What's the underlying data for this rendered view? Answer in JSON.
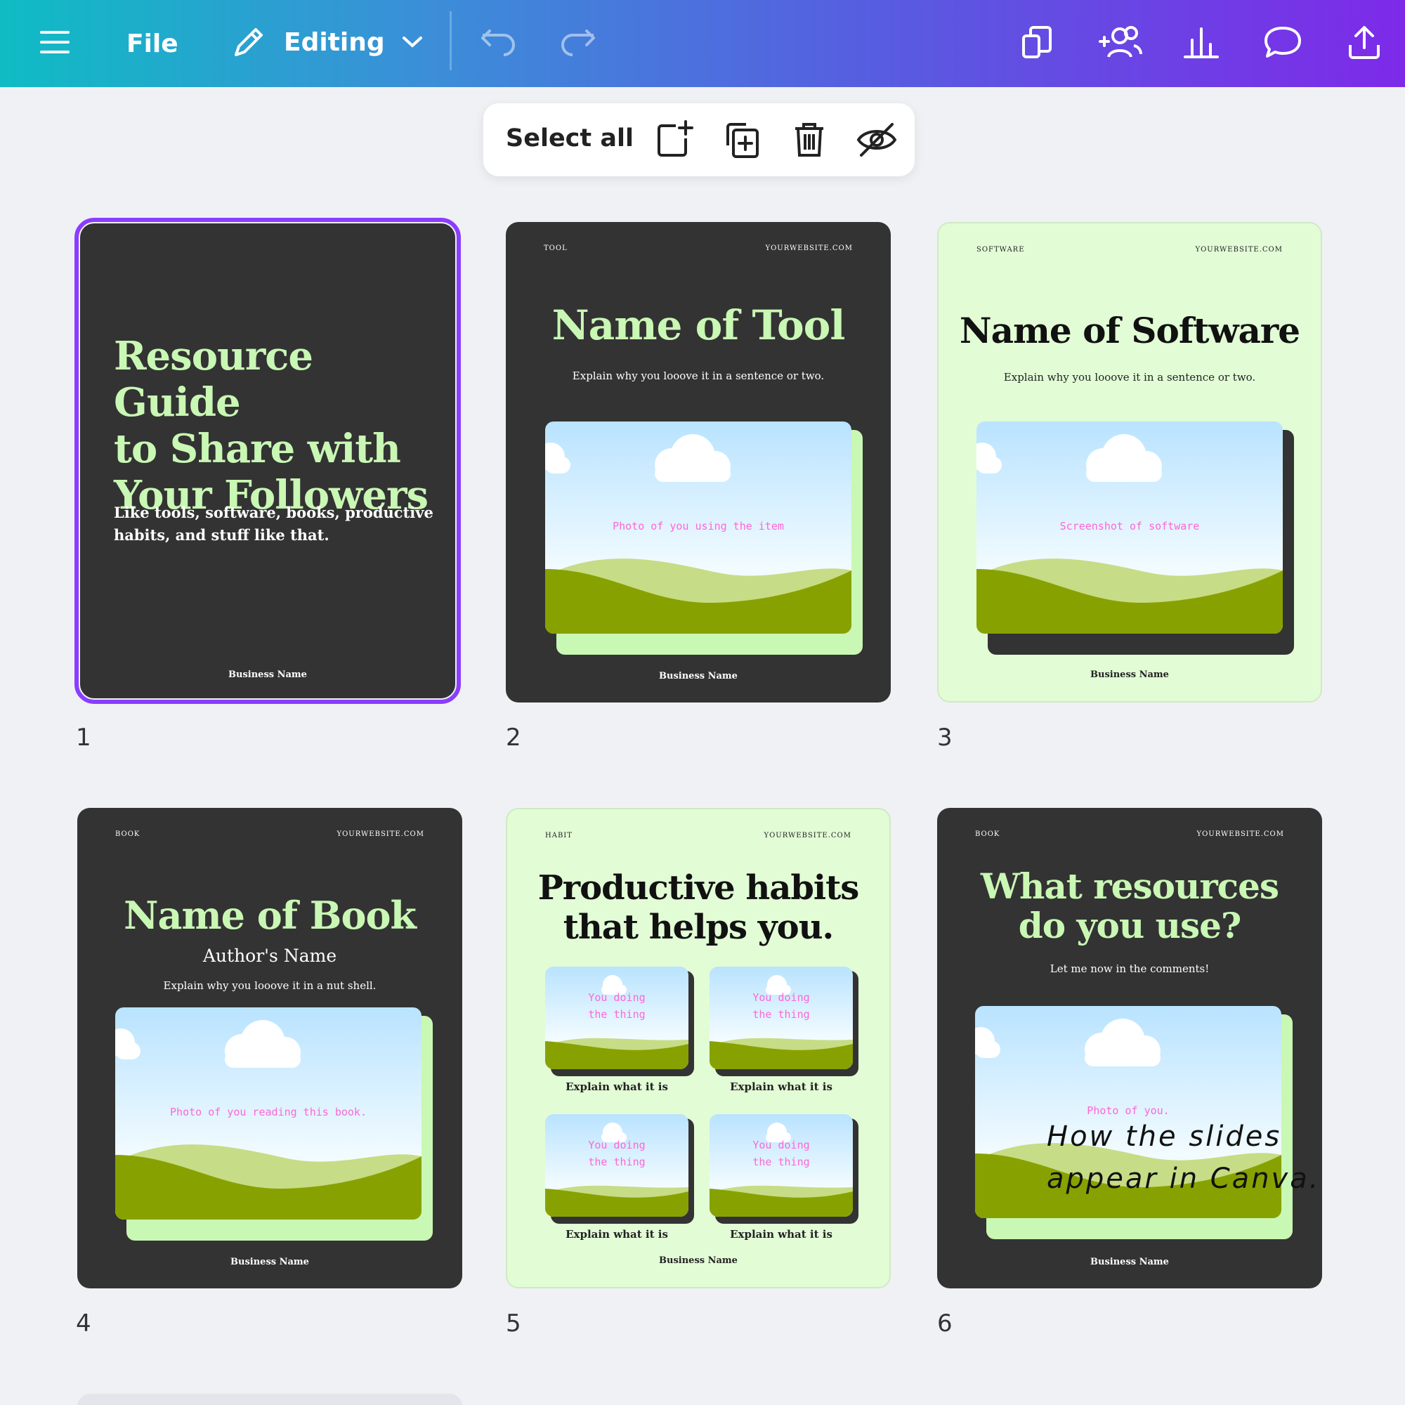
{
  "topbar": {
    "menu_icon": "hamburger-icon",
    "file_label": "File",
    "mode_label": "Editing",
    "icons": [
      "pencil-icon",
      "chevron-down-icon",
      "undo-icon",
      "redo-icon",
      "copy-pages-icon",
      "add-collaborator-icon",
      "insights-icon",
      "comment-icon",
      "share-icon"
    ]
  },
  "selection_toolbar": {
    "select_all_label": "Select all",
    "icons": [
      "add-page-icon",
      "duplicate-page-icon",
      "delete-icon",
      "hide-icon"
    ]
  },
  "pages": [
    {
      "number": "1",
      "theme": "dark",
      "selected": true,
      "title_lines": [
        "Resource Guide",
        "to Share with",
        "Your Followers"
      ],
      "subtitle_lines": [
        "Like tools, software, books, productive",
        "habits, and stuff like that."
      ],
      "business": "Business Name"
    },
    {
      "number": "2",
      "theme": "dark",
      "tag": "TOOL",
      "website": "YOURWEBSITE.COM",
      "title": "Name of Tool",
      "subtitle": "Explain why you looove it in a sentence or two.",
      "photo_text": "Photo of you using the item",
      "business": "Business Name"
    },
    {
      "number": "3",
      "theme": "light",
      "tag": "SOFTWARE",
      "website": "YOURWEBSITE.COM",
      "title": "Name of Software",
      "subtitle": "Explain why you looove it in a sentence or two.",
      "photo_text": "Screenshot of software",
      "business": "Business Name"
    },
    {
      "number": "4",
      "theme": "dark",
      "tag": "BOOK",
      "website": "YOURWEBSITE.COM",
      "title": "Name of Book",
      "author": "Author's Name",
      "subtitle": "Explain why you looove it in a nut shell.",
      "photo_text": "Photo of you reading this book.",
      "business": "Business Name"
    },
    {
      "number": "5",
      "theme": "light",
      "tag": "HABIT",
      "website": "YOURWEBSITE.COM",
      "title_lines": [
        "Productive habits",
        "that helps you."
      ],
      "photo_text_lines": [
        "You doing",
        "the thing"
      ],
      "caption": "Explain what it is",
      "business": "Business Name"
    },
    {
      "number": "6",
      "theme": "dark",
      "tag": "BOOK",
      "website": "YOURWEBSITE.COM",
      "title_lines": [
        "What resources",
        "do you use?"
      ],
      "subtitle": "Let me now in the comments!",
      "photo_text": "Photo of you.",
      "business": "Business Name"
    }
  ],
  "overlay_note_lines": [
    "How the slides",
    "appear in Canva."
  ],
  "colors": {
    "accent_selection": "#8b3dff",
    "dark_page": "#333333",
    "light_page": "#e2fcd6",
    "green_title": "#c9f7b4",
    "placeholder_text": "#ff66d6"
  }
}
